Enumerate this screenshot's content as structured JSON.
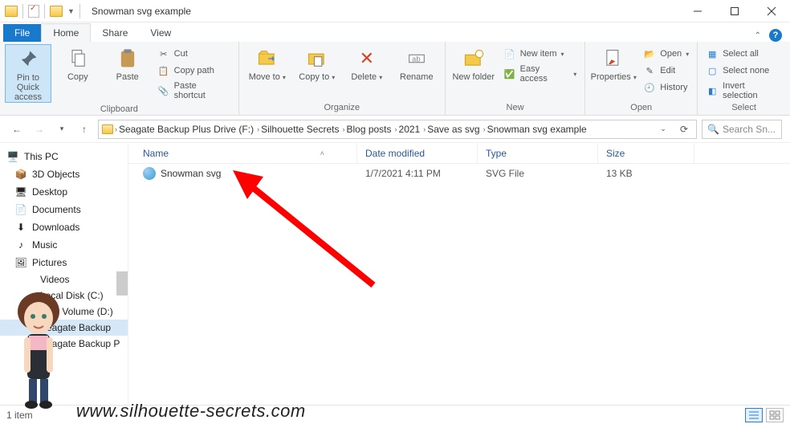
{
  "window": {
    "title": "Snowman svg example"
  },
  "tabs": {
    "file": "File",
    "home": "Home",
    "share": "Share",
    "view": "View"
  },
  "ribbon": {
    "pin": "Pin to Quick access",
    "copy": "Copy",
    "paste": "Paste",
    "cut": "Cut",
    "copy_path": "Copy path",
    "paste_shortcut": "Paste shortcut",
    "clipboard": "Clipboard",
    "move_to": "Move to",
    "copy_to": "Copy to",
    "delete": "Delete",
    "rename": "Rename",
    "organize": "Organize",
    "new_folder": "New folder",
    "new_item": "New item",
    "easy_access": "Easy access",
    "new": "New",
    "properties": "Properties",
    "open": "Open",
    "edit": "Edit",
    "history": "History",
    "open_group": "Open",
    "select_all": "Select all",
    "select_none": "Select none",
    "invert_selection": "Invert selection",
    "select": "Select"
  },
  "breadcrumbs": [
    "Seagate Backup Plus Drive (F:)",
    "Silhouette Secrets",
    "Blog posts",
    "2021",
    "Save as svg",
    "Snowman svg example"
  ],
  "search": {
    "placeholder": "Search Sn..."
  },
  "columns": {
    "name": "Name",
    "date": "Date modified",
    "type": "Type",
    "size": "Size"
  },
  "files": [
    {
      "name": "Snowman svg",
      "date": "1/7/2021 4:11 PM",
      "type": "SVG File",
      "size": "13 KB"
    }
  ],
  "navpane": {
    "this_pc": "This PC",
    "items": [
      "3D Objects",
      "Desktop",
      "Documents",
      "Downloads",
      "Music",
      "Pictures",
      "Videos",
      "Local Disk (C:)",
      "New Volume (D:)",
      "Seagate Backup",
      "Seagate Backup P"
    ]
  },
  "status": {
    "count": "1 item"
  },
  "overlay_url": "www.silhouette-secrets.com"
}
